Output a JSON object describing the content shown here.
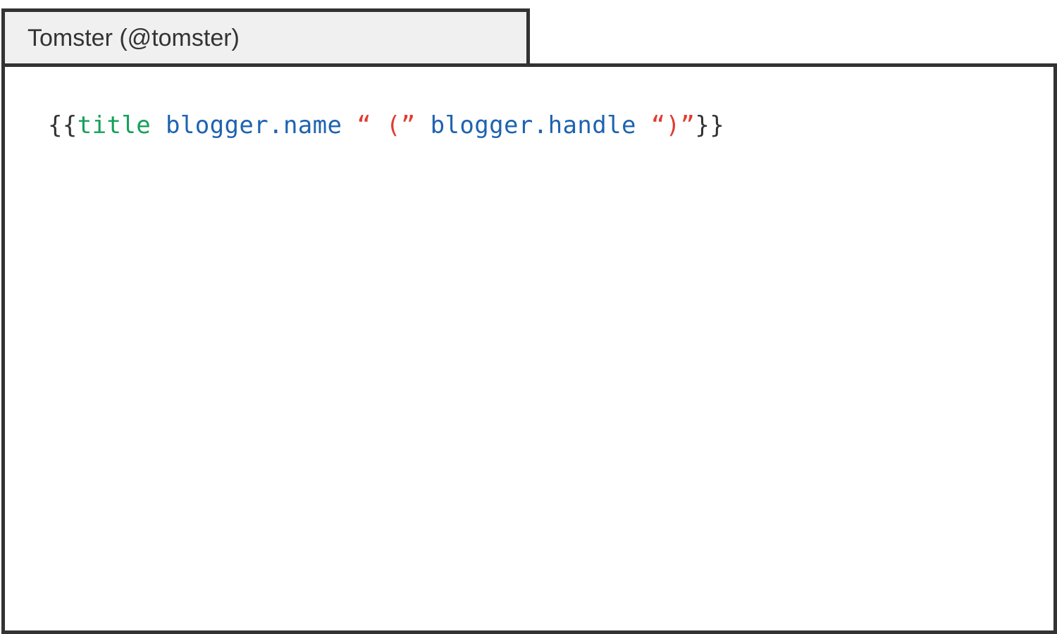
{
  "tab": {
    "title": "Tomster (@tomster)"
  },
  "code": {
    "tokens": {
      "open": "{{",
      "helper": "title",
      "space1": " ",
      "path1": "blogger.name",
      "space2": " ",
      "string1": "“ (”",
      "space3": " ",
      "path2": "blogger.handle",
      "space4": " ",
      "string2": "“)”",
      "close": "}}"
    }
  },
  "colors": {
    "border": "#333333",
    "tab_background": "#f0f0f0",
    "helper": "#16a05a",
    "path": "#1e63b0",
    "string": "#e03c31",
    "brace": "#333333"
  }
}
